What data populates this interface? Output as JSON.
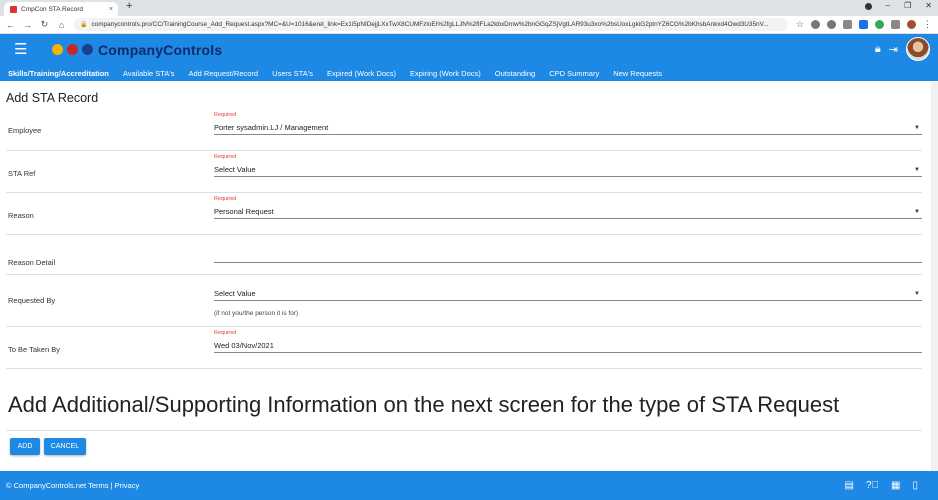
{
  "browser": {
    "tab_title": "CmpCon STA Record",
    "url": "companycontrols.pro/CC/TrainingCourse_Add_Request.aspx?MC=&U=1016&eret_link=Ex1i5pNIDejjLXxTwX8CUMFzloEI%2fgLLJN%2fIFLa2kbxDmw%2bnGGqZSjVgtLAR93u3xo%2bsUoxLgkiG2ptnYZ6CG%2bKhsbAnkxd4Owd3U35nV...",
    "new_tab": "+",
    "close_tab": "×"
  },
  "app": {
    "name": "CompanyControls",
    "accent_color": "#1e88e5"
  },
  "nav": {
    "items": [
      "Skills/Training/Accreditation",
      "Available STA's",
      "Add Request/Record",
      "Users STA's",
      "Expired (Work Docs)",
      "Expiring (Work Docs)",
      "Outstanding",
      "CPD Summary",
      "New Requests"
    ]
  },
  "page": {
    "title": "Add STA Record"
  },
  "form": {
    "required_label": "Required",
    "employee_label": "Employee",
    "employee_value": "Porter sysadmin.LJ / Management",
    "sta_ref_label": "STA Ref",
    "sta_ref_value": "Select Value",
    "reason_label": "Reason",
    "reason_value": "Personal Request",
    "reason_detail_label": "Reason Detail",
    "reason_detail_value": "",
    "requested_by_label": "Requested By",
    "requested_by_value": "Select Value",
    "requested_by_hint": "(if not you/the person it is for)",
    "taken_by_label": "To Be Taken By",
    "taken_by_value": "Wed 03/Nov/2021"
  },
  "supplementary": "Add Additional/Supporting Information on the next screen for the type of STA Request",
  "buttons": {
    "add": "ADD",
    "cancel": "CANCEL"
  },
  "footer": {
    "text": "© CompanyControls.net Terms | Privacy"
  },
  "icons": {
    "hamburger": "menu-icon",
    "lock": "lock-icon",
    "logout": "logout-icon",
    "chat": "chat-icon",
    "help": "help-icon",
    "messages": "messages-icon",
    "mobile": "mobile-icon"
  }
}
